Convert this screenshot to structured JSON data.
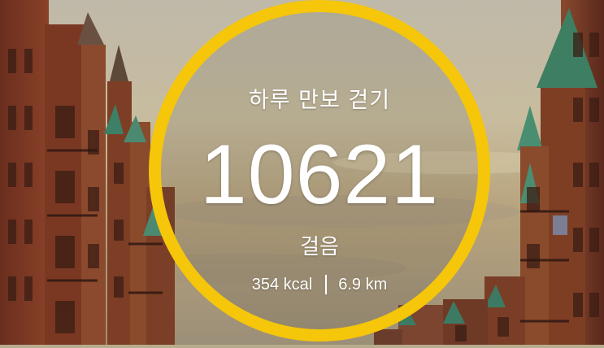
{
  "walk": {
    "title": "하루 만보 걷기",
    "steps": "10621",
    "steps_unit": "걸음",
    "calories": "354 kcal",
    "distance": "6.9 km"
  },
  "colors": {
    "ring": "#f5c60a",
    "text": "#ffffff"
  }
}
